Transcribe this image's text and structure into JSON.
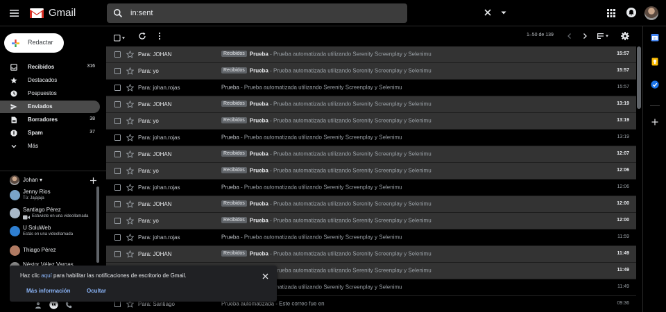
{
  "app": {
    "name": "Gmail"
  },
  "search": {
    "value": "in:sent"
  },
  "compose": {
    "label": "Redactar"
  },
  "nav": [
    {
      "label": "Recibidos",
      "count": "316",
      "bold": true,
      "icon": "inbox-icon",
      "active": false
    },
    {
      "label": "Destacados",
      "count": "",
      "bold": false,
      "icon": "star-icon",
      "active": false
    },
    {
      "label": "Pospuestos",
      "count": "",
      "bold": false,
      "icon": "clock-icon",
      "active": false
    },
    {
      "label": "Enviados",
      "count": "",
      "bold": true,
      "icon": "send-icon",
      "active": true
    },
    {
      "label": "Borradores",
      "count": "38",
      "bold": true,
      "icon": "draft-icon",
      "active": false
    },
    {
      "label": "Spam",
      "count": "37",
      "bold": true,
      "icon": "spam-icon",
      "active": false
    },
    {
      "label": "Más",
      "count": "",
      "bold": false,
      "icon": "chevron-down-icon",
      "active": false
    }
  ],
  "hangouts": {
    "user": "Johan",
    "contacts": [
      {
        "name": "Jenny Rios",
        "status": "Tú: Jajajaja",
        "color": "#7aa4c9"
      },
      {
        "name": "Santiago Pérez",
        "status": "Estuviste en una videollamada",
        "color": "#a8b8c8"
      },
      {
        "name": "U SoluWeb",
        "status": "Estás en una videollamada",
        "color": "#2f7fd1"
      },
      {
        "name": "Thiago Pérez",
        "status": "",
        "color": "#b07a62"
      },
      {
        "name": "Néstor Vélez Vargas",
        "status": "",
        "color": "#8a8a8a"
      }
    ]
  },
  "toolbar": {
    "pagination": "1–50 de 139"
  },
  "emails": [
    {
      "sender": "Para: JOHAN",
      "label": "Recibidos",
      "subject": "Prueba",
      "snippet": " - Prueba automatizada utilizando Serenity Screenplay y Selenimu",
      "time": "15:57",
      "unread": true
    },
    {
      "sender": "Para: yo",
      "label": "Recibidos",
      "subject": "Prueba",
      "snippet": " - Prueba automatizada utilizando Serenity Screenplay y Selenimu",
      "time": "15:57",
      "unread": true
    },
    {
      "sender": "Para: johan.rojas",
      "label": "",
      "subject": "Prueba",
      "snippet": " - Prueba automatizada utilizando Serenity Screenplay y Selenimu",
      "time": "15:57",
      "unread": false
    },
    {
      "sender": "Para: JOHAN",
      "label": "Recibidos",
      "subject": "Prueba",
      "snippet": " - Prueba automatizada utilizando Serenity Screenplay y Selenimu",
      "time": "13:19",
      "unread": true
    },
    {
      "sender": "Para: yo",
      "label": "Recibidos",
      "subject": "Prueba",
      "snippet": " - Prueba automatizada utilizando Serenity Screenplay y Selenimu",
      "time": "13:19",
      "unread": true
    },
    {
      "sender": "Para: johan.rojas",
      "label": "",
      "subject": "Prueba",
      "snippet": " - Prueba automatizada utilizando Serenity Screenplay y Selenimu",
      "time": "13:19",
      "unread": false
    },
    {
      "sender": "Para: JOHAN",
      "label": "Recibidos",
      "subject": "Prueba",
      "snippet": " - Prueba automatizada utilizando Serenity Screenplay y Selenimu",
      "time": "12:07",
      "unread": true
    },
    {
      "sender": "Para: yo",
      "label": "Recibidos",
      "subject": "Prueba",
      "snippet": " - Prueba automatizada utilizando Serenity Screenplay y Selenimu",
      "time": "12:06",
      "unread": true
    },
    {
      "sender": "Para: johan.rojas",
      "label": "",
      "subject": "Prueba",
      "snippet": " - Prueba automatizada utilizando Serenity Screenplay y Selenimu",
      "time": "12:06",
      "unread": false
    },
    {
      "sender": "Para: JOHAN",
      "label": "Recibidos",
      "subject": "Prueba",
      "snippet": " - Prueba automatizada utilizando Serenity Screenplay y Selenimu",
      "time": "12:00",
      "unread": true
    },
    {
      "sender": "Para: yo",
      "label": "Recibidos",
      "subject": "Prueba",
      "snippet": " - Prueba automatizada utilizando Serenity Screenplay y Selenimu",
      "time": "12:00",
      "unread": true
    },
    {
      "sender": "Para: johan.rojas",
      "label": "",
      "subject": "Prueba",
      "snippet": " - Prueba automatizada utilizando Serenity Screenplay y Selenimu",
      "time": "11:59",
      "unread": false
    },
    {
      "sender": "Para: JOHAN",
      "label": "Recibidos",
      "subject": "Prueba",
      "snippet": " - Prueba automatizada utilizando Serenity Screenplay y Selenimu",
      "time": "11:49",
      "unread": true
    },
    {
      "sender": "Para: yo",
      "label": "Recibidos",
      "subject": "Prueba",
      "snippet": " - Prueba automatizada utilizando Serenity Screenplay y Selenimu",
      "time": "11:49",
      "unread": true
    },
    {
      "sender": "Para: johan.rojas",
      "label": "",
      "subject": "Prueba",
      "snippet": " - Prueba automatizada utilizando Serenity Screenplay y Selenimu",
      "time": "11:49",
      "unread": false
    },
    {
      "sender": "Para: Santiago",
      "label": "",
      "subject": "Prueba automatizada",
      "snippet": " - Este correo fue en",
      "time": "09:36",
      "unread": false
    }
  ],
  "notification": {
    "prefix": "Haz clic ",
    "link": "aquí",
    "suffix": " para habilitar las notificaciones de escritorio de Gmail.",
    "more_info": "Más información",
    "hide": "Ocultar"
  }
}
